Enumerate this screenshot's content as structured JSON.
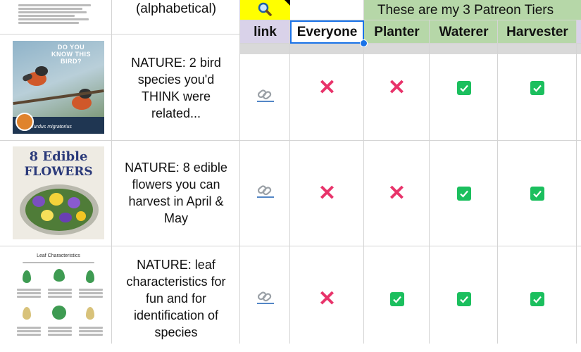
{
  "columns": {
    "link": "link",
    "everyone": "Everyone",
    "planter": "Planter",
    "waterer": "Waterer",
    "harvester": "Harvester"
  },
  "tiers_banner": "These are my 3 Patreon Tiers",
  "top_row_desc": "(alphabetical)",
  "rows": [
    {
      "desc": "NATURE: 2 bird species you'd THINK were related...",
      "thumb_title": "DO YOU KNOW THIS BIRD?",
      "thumb_caption": "Turdus migratorius",
      "everyone": "x",
      "planter": "x",
      "waterer": "check",
      "harvester": "check"
    },
    {
      "desc": "NATURE: 8 edible flowers you can harvest in April & May",
      "thumb_title_1": "8 Edible",
      "thumb_title_2": "FLOWERS",
      "everyone": "x",
      "planter": "x",
      "waterer": "check",
      "harvester": "check"
    },
    {
      "desc": "NATURE: leaf characteristics for fun and for identification of species",
      "thumb_title": "Leaf Characteristics",
      "everyone": "x",
      "planter": "check",
      "waterer": "check",
      "harvester": "check"
    }
  ],
  "colors": {
    "header_purple": "#d9d2e9",
    "tier_green": "#b6d7a8",
    "search_yellow": "#ffff00",
    "x_red": "#e8336a",
    "check_green": "#1bbf5e",
    "selection_blue": "#1a73e8"
  },
  "icons": {
    "search": "search-icon",
    "link": "link-icon",
    "x": "x-mark-icon",
    "check": "checkbox-checked-icon"
  }
}
